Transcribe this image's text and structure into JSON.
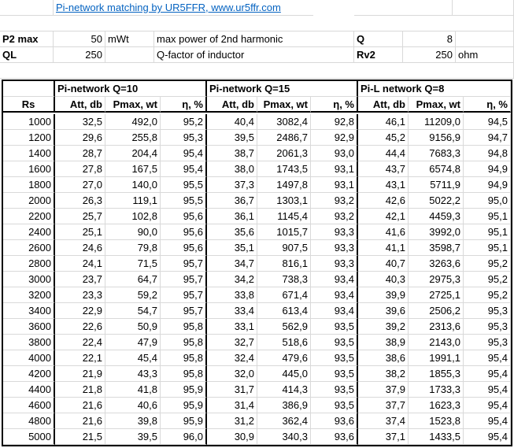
{
  "title": "Pi-network matching by UR5FFR, www.ur5ffr.com",
  "params": [
    {
      "label": "P2 max",
      "value": "50",
      "unit": "mWt",
      "desc": "max power of 2nd harmonic",
      "label2": "Q",
      "value2": "8",
      "unit2": ""
    },
    {
      "label": "QL",
      "value": "250",
      "unit": "",
      "desc": "Q-factor of inductor",
      "label2": "Rv2",
      "value2": "250",
      "unit2": "ohm"
    }
  ],
  "groups": [
    "Pi-network Q=10",
    "Pi-network Q=15",
    "Pi-L network Q=8"
  ],
  "columns": [
    "Rs",
    "Att, db",
    "Pmax, wt",
    "η, %",
    "Att, db",
    "Pmax, wt",
    "η, %",
    "Att, db",
    "Pmax, wt",
    "η, %"
  ],
  "rows": [
    [
      "1000",
      "32,5",
      "492,0",
      "95,2",
      "40,4",
      "3082,4",
      "92,8",
      "46,1",
      "11209,0",
      "94,5"
    ],
    [
      "1200",
      "29,6",
      "255,8",
      "95,3",
      "39,5",
      "2486,7",
      "92,9",
      "45,2",
      "9156,9",
      "94,7"
    ],
    [
      "1400",
      "28,7",
      "204,4",
      "95,4",
      "38,7",
      "2061,3",
      "93,0",
      "44,4",
      "7683,3",
      "94,8"
    ],
    [
      "1600",
      "27,8",
      "167,5",
      "95,4",
      "38,0",
      "1743,5",
      "93,1",
      "43,7",
      "6574,8",
      "94,9"
    ],
    [
      "1800",
      "27,0",
      "140,0",
      "95,5",
      "37,3",
      "1497,8",
      "93,1",
      "43,1",
      "5711,9",
      "94,9"
    ],
    [
      "2000",
      "26,3",
      "119,1",
      "95,5",
      "36,7",
      "1303,1",
      "93,2",
      "42,6",
      "5022,2",
      "95,0"
    ],
    [
      "2200",
      "25,7",
      "102,8",
      "95,6",
      "36,1",
      "1145,4",
      "93,2",
      "42,1",
      "4459,3",
      "95,1"
    ],
    [
      "2400",
      "25,1",
      "90,0",
      "95,6",
      "35,6",
      "1015,7",
      "93,3",
      "41,6",
      "3992,0",
      "95,1"
    ],
    [
      "2600",
      "24,6",
      "79,8",
      "95,6",
      "35,1",
      "907,5",
      "93,3",
      "41,1",
      "3598,7",
      "95,1"
    ],
    [
      "2800",
      "24,1",
      "71,5",
      "95,7",
      "34,7",
      "816,1",
      "93,3",
      "40,7",
      "3263,6",
      "95,2"
    ],
    [
      "3000",
      "23,7",
      "64,7",
      "95,7",
      "34,2",
      "738,3",
      "93,4",
      "40,3",
      "2975,3",
      "95,2"
    ],
    [
      "3200",
      "23,3",
      "59,2",
      "95,7",
      "33,8",
      "671,4",
      "93,4",
      "39,9",
      "2725,1",
      "95,2"
    ],
    [
      "3400",
      "22,9",
      "54,7",
      "95,7",
      "33,4",
      "613,4",
      "93,4",
      "39,6",
      "2506,2",
      "95,3"
    ],
    [
      "3600",
      "22,6",
      "50,9",
      "95,8",
      "33,1",
      "562,9",
      "93,5",
      "39,2",
      "2313,6",
      "95,3"
    ],
    [
      "3800",
      "22,4",
      "47,9",
      "95,8",
      "32,7",
      "518,6",
      "93,5",
      "38,9",
      "2143,0",
      "95,3"
    ],
    [
      "4000",
      "22,1",
      "45,4",
      "95,8",
      "32,4",
      "479,6",
      "93,5",
      "38,6",
      "1991,1",
      "95,4"
    ],
    [
      "4200",
      "21,9",
      "43,3",
      "95,8",
      "32,0",
      "445,0",
      "93,5",
      "38,2",
      "1855,3",
      "95,4"
    ],
    [
      "4400",
      "21,8",
      "41,8",
      "95,9",
      "31,7",
      "414,3",
      "93,5",
      "37,9",
      "1733,3",
      "95,4"
    ],
    [
      "4600",
      "21,6",
      "40,6",
      "95,9",
      "31,4",
      "386,9",
      "93,5",
      "37,7",
      "1623,3",
      "95,4"
    ],
    [
      "4800",
      "21,6",
      "39,8",
      "95,9",
      "31,2",
      "362,4",
      "93,6",
      "37,4",
      "1523,8",
      "95,4"
    ],
    [
      "5000",
      "21,5",
      "39,5",
      "96,0",
      "30,9",
      "340,3",
      "93,6",
      "37,1",
      "1433,5",
      "95,4"
    ]
  ]
}
